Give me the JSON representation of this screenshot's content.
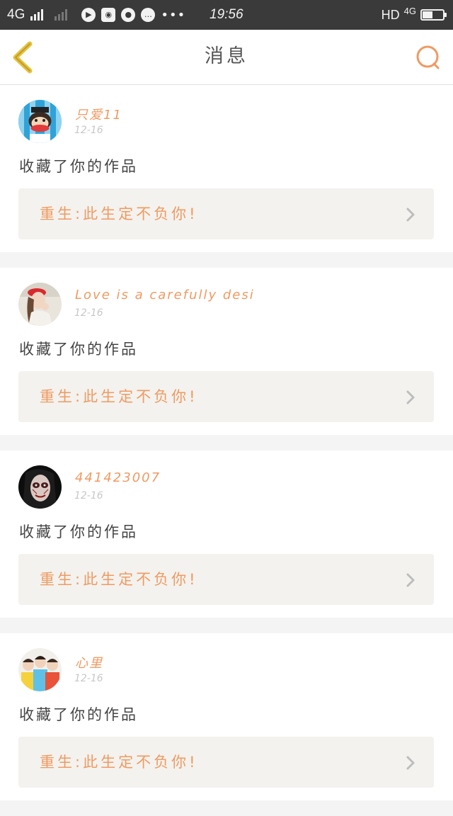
{
  "status_bar": {
    "network": "4G",
    "time": "19:56",
    "hd": "HD",
    "network_right": "4G",
    "battery_level": 0.5,
    "icons": [
      "signal-icon",
      "signal-weak-icon",
      "play-icon",
      "browser-icon",
      "wechat-icon",
      "chat-bubble-icon",
      "more-dots-icon",
      "battery-icon"
    ]
  },
  "header": {
    "title": "消息",
    "back_icon": "chevron-left-icon",
    "search_icon": "search-icon"
  },
  "colors": {
    "accent": "#f09a62",
    "back_icon": "#e8c23a",
    "card_bg": "#ffffff",
    "link_bg": "#f3f2ee",
    "page_bg": "#f4f4f4"
  },
  "messages": [
    {
      "username": "只爱11",
      "date": "12-16",
      "action": "收藏了你的作品",
      "work_title": "重生:此生定不负你!",
      "avatar": "monkey-avatar"
    },
    {
      "username": "Love is a carefully desi",
      "date": "12-16",
      "action": "收藏了你的作品",
      "work_title": "重生:此生定不负你!",
      "avatar": "girl-red-hat-avatar"
    },
    {
      "username": "441423007",
      "date": "12-16",
      "action": "收藏了你的作品",
      "work_title": "重生:此生定不负你!",
      "avatar": "face-paint-avatar"
    },
    {
      "username": "心里",
      "date": "12-16",
      "action": "收藏了你的作品",
      "work_title": "重生:此生定不负你!",
      "avatar": "three-boys-avatar"
    }
  ]
}
